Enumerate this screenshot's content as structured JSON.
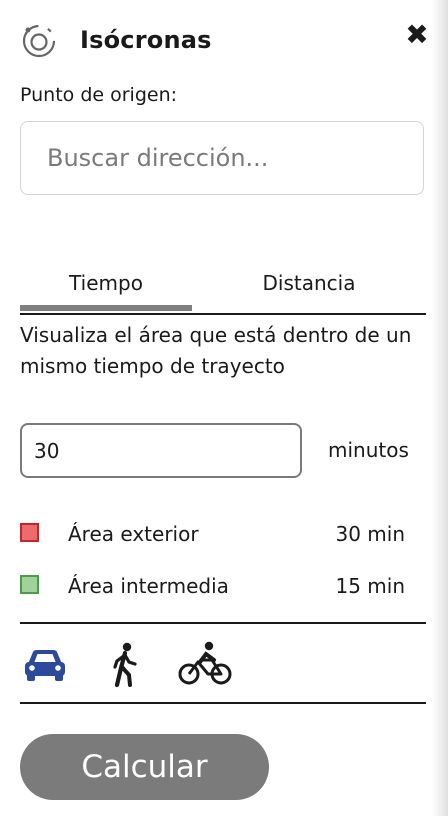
{
  "header": {
    "title": "Isócronas",
    "close_symbol": "✖",
    "logo_icon": "isochrone-logo-icon",
    "close_icon": "close-icon"
  },
  "origin": {
    "label": "Punto de origen:",
    "placeholder": "Buscar dirección...",
    "value": ""
  },
  "tabs": {
    "items": [
      {
        "label": "Tiempo",
        "active": true
      },
      {
        "label": "Distancia",
        "active": false
      }
    ]
  },
  "description": "Visualiza el área que está dentro de un mismo tiempo de trayecto",
  "time": {
    "value": "30",
    "unit": "minutos"
  },
  "legend": [
    {
      "label": "Área exterior",
      "value": "30 min",
      "fill": "#ee6b6b",
      "border": "#c0272d"
    },
    {
      "label": "Área intermedia",
      "value": "15 min",
      "fill": "#9fd39a",
      "border": "#4f9a4b"
    }
  ],
  "modes": [
    {
      "icon": "car-icon",
      "active": true,
      "color": "#2c4a9c"
    },
    {
      "icon": "walking-person-icon",
      "active": false,
      "color": "#1a1a1a"
    },
    {
      "icon": "bicycle-icon",
      "active": false,
      "color": "#1a1a1a"
    }
  ],
  "actions": {
    "calculate_label": "Calcular"
  },
  "colors": {
    "active_mode": "#2c4a9c",
    "tab_indicator": "#808080",
    "button_bg": "#7b7b7b"
  }
}
